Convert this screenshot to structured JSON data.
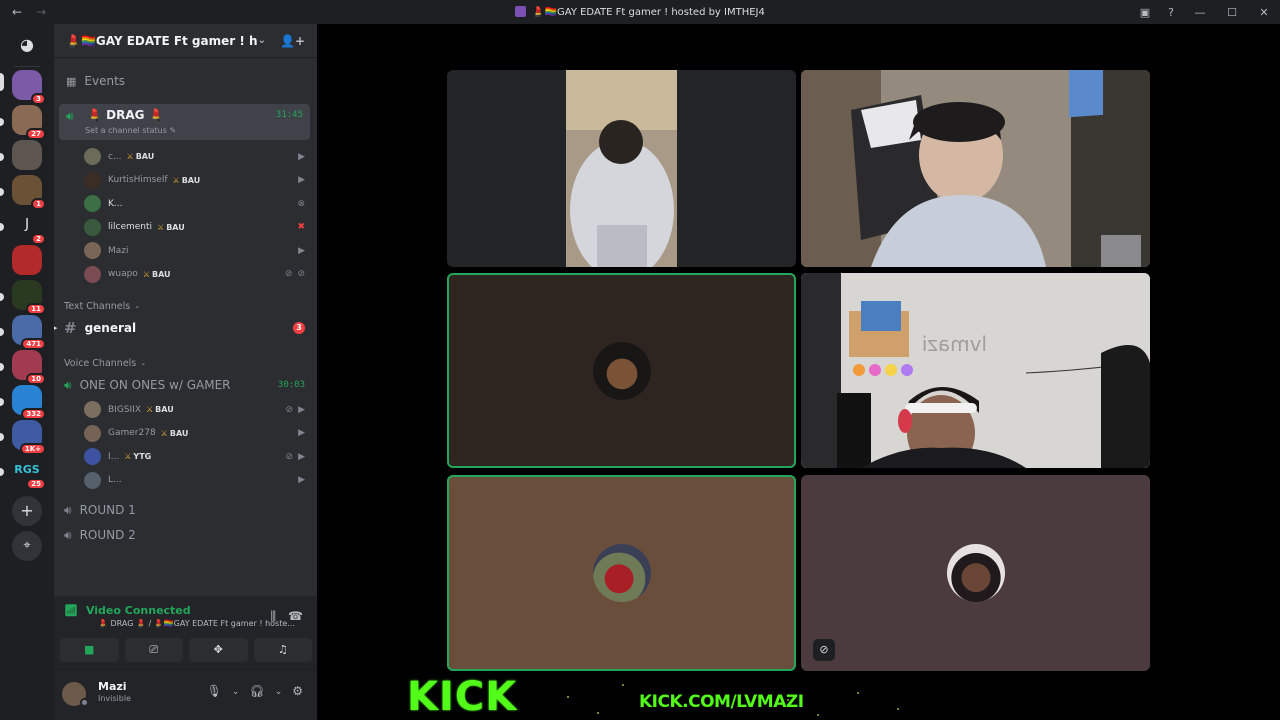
{
  "window": {
    "title": "💄🏳️‍🌈GAY EDATE Ft gamer ! hosted by IMTHEJ4",
    "back": "←",
    "forward": "→",
    "controls": [
      "—",
      "☐",
      "✕"
    ]
  },
  "servers": {
    "badges": [
      "3",
      "27",
      "",
      "1",
      "2",
      "",
      "11",
      "471",
      "10",
      "332",
      "1K+",
      "25"
    ],
    "letter_j": "J",
    "text_rgs": "RGS",
    "add_label": "+",
    "discover_label": "⌖"
  },
  "guild": {
    "name": "💄🏳️‍🌈GAY EDATE Ft gamer ! hoste...",
    "events_label": "Events",
    "active_channel": {
      "name": "💄 DRAG 💄",
      "timer": "31:45",
      "status_hint": "Set a channel status ✎"
    },
    "drag_users": [
      {
        "name": "c...",
        "tag": "BAU",
        "av": "#6c6a58",
        "icons": [
          "▶"
        ]
      },
      {
        "name": "KurtisHimself",
        "tag": "BAU",
        "av": "#3b2c24",
        "icons": [
          "▶"
        ]
      },
      {
        "name": "K...",
        "tag": "",
        "av": "#3c6f46",
        "icons": [
          "⊗"
        ],
        "bright": true
      },
      {
        "name": "lilcementi",
        "tag": "BAU",
        "av": "#3a5a3f",
        "icons": [
          "✖"
        ],
        "bright": true
      },
      {
        "name": "Mazi",
        "tag": "",
        "av": "#7a6656",
        "icons": [
          "▶"
        ]
      },
      {
        "name": "wuapo",
        "tag": "BAU",
        "av": "#7a4b52",
        "icons": [
          "⊘",
          "⊘"
        ]
      }
    ],
    "text_category": "Text Channels",
    "text_channels": [
      {
        "name": "general",
        "count": "3"
      }
    ],
    "voice_category": "Voice Channels",
    "voice_channel": {
      "name": "ONE ON ONES w/ GAMER",
      "timer": "30:03"
    },
    "ones_users": [
      {
        "name": "BIGSIIX",
        "tag": "BAU",
        "av": "#7d6e62",
        "icons": [
          "⊘",
          "▶"
        ]
      },
      {
        "name": "Gamer278",
        "tag": "BAU",
        "av": "#756358",
        "icons": [
          "▶"
        ]
      },
      {
        "name": "I...",
        "tag": "YTG",
        "av": "#3d53a1",
        "icons": [
          "⊘",
          "▶"
        ]
      },
      {
        "name": "L...",
        "tag": "",
        "av": "#56606b",
        "icons": [
          "▶"
        ]
      }
    ],
    "other_voice": [
      "ROUND 1",
      "ROUND 2"
    ]
  },
  "voice_panel": {
    "status": "Video Connected",
    "location": "💄 DRAG 💄 / 💄🏳️‍🌈GAY EDATE Ft gamer ! hoste...",
    "buttons": [
      "camera",
      "screen-share",
      "activities",
      "soundboard"
    ]
  },
  "user_panel": {
    "name": "Mazi",
    "status": "Invisible"
  },
  "overlay": {
    "kick_logo": "KICK",
    "kick_url": "KICK.COM/LVMAZI"
  },
  "colors": {
    "accent_green": "#23a55a",
    "kick_green": "#53fc18",
    "danger": "#f23f43"
  }
}
